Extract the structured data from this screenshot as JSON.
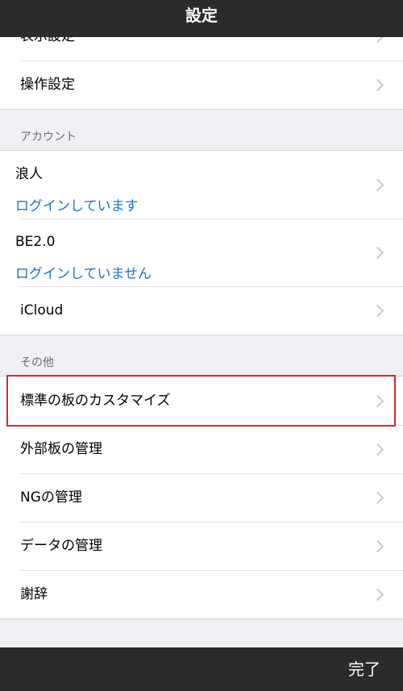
{
  "navbar": {
    "title": "設定"
  },
  "groups": {
    "top": {
      "items": [
        {
          "label": "表示設定"
        },
        {
          "label": "操作設定"
        }
      ]
    },
    "account": {
      "header": "アカウント",
      "items": [
        {
          "label": "浪人",
          "status": "ログインしています"
        },
        {
          "label": "BE2.0",
          "status": "ログインしていません"
        },
        {
          "label": "iCloud"
        }
      ]
    },
    "other": {
      "header": "その他",
      "items": [
        {
          "label": "標準の板のカスタマイズ"
        },
        {
          "label": "外部板の管理"
        },
        {
          "label": "NGの管理"
        },
        {
          "label": "データの管理"
        },
        {
          "label": "謝辞"
        }
      ]
    }
  },
  "toolbar": {
    "done_label": "完了"
  },
  "colors": {
    "bar_background": "#2b2b2b",
    "link_blue": "#1a73c8",
    "highlight_red": "#d6262b",
    "page_background": "#efeff4"
  }
}
